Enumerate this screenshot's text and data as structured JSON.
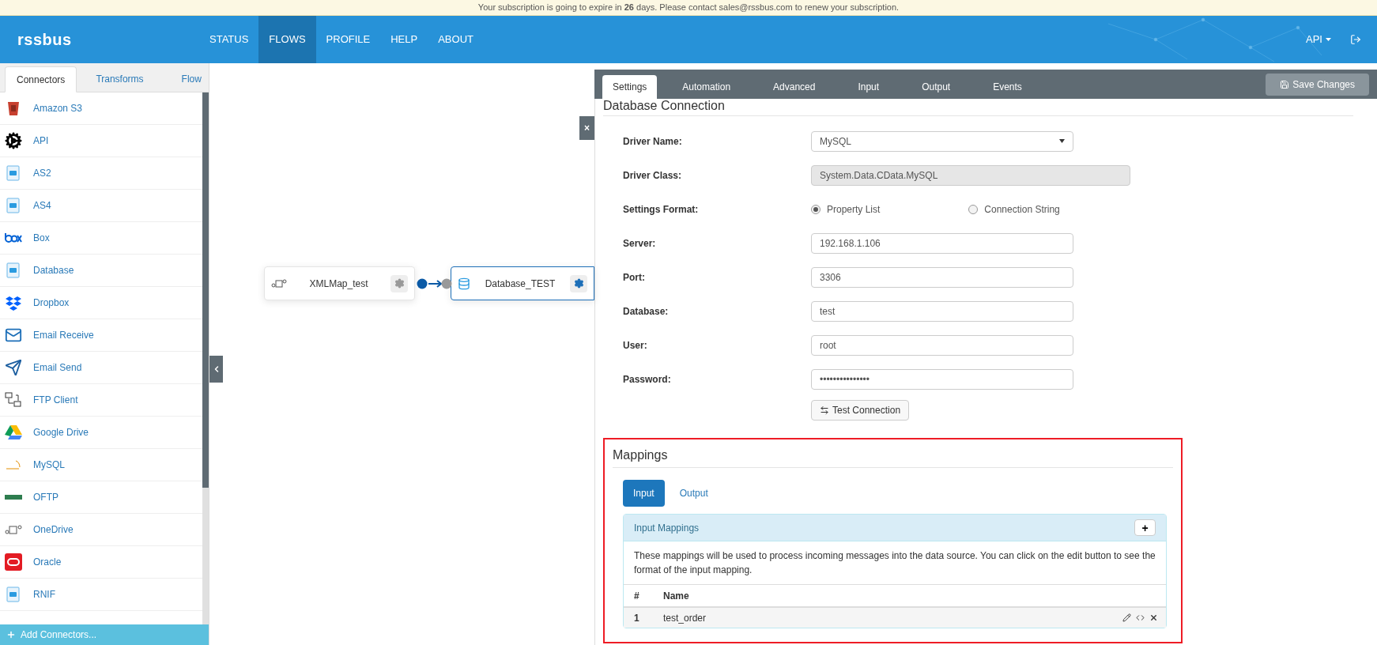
{
  "banner": {
    "text": "Your subscription is going to expire in **26** days. Please contact sales@rssbus.com to renew your subscription."
  },
  "header": {
    "logo": "rssbus",
    "nav": [
      {
        "label": "STATUS",
        "selected": false
      },
      {
        "label": "FLOWS",
        "selected": true
      },
      {
        "label": "PROFILE",
        "selected": false
      },
      {
        "label": "HELP",
        "selected": false
      },
      {
        "label": "ABOUT",
        "selected": false
      }
    ],
    "user_menu": "API"
  },
  "sidebar": {
    "tabs": [
      {
        "label": "Connectors",
        "selected": true
      },
      {
        "label": "Transforms",
        "selected": false
      },
      {
        "label": "Flow",
        "selected": false
      }
    ],
    "items": [
      {
        "label": "Amazon S3"
      },
      {
        "label": "API"
      },
      {
        "label": "AS2"
      },
      {
        "label": "AS4"
      },
      {
        "label": "Box"
      },
      {
        "label": "Database"
      },
      {
        "label": "Dropbox"
      },
      {
        "label": "Email Receive"
      },
      {
        "label": "Email Send"
      },
      {
        "label": "FTP Client"
      },
      {
        "label": "Google Drive"
      },
      {
        "label": "MySQL"
      },
      {
        "label": "OFTP"
      },
      {
        "label": "OneDrive"
      },
      {
        "label": "Oracle"
      },
      {
        "label": "RNIF"
      }
    ],
    "add_button": "Add Connectors..."
  },
  "canvas": {
    "nodes": [
      {
        "label": "XMLMap_test",
        "selected": false
      },
      {
        "label": "Database_TEST",
        "selected": true
      }
    ],
    "close_button": "×"
  },
  "panel": {
    "tabs": [
      {
        "label": "Settings",
        "selected": true
      },
      {
        "label": "Automation",
        "selected": false
      },
      {
        "label": "Advanced",
        "selected": false
      },
      {
        "label": "Input",
        "selected": false
      },
      {
        "label": "Output",
        "selected": false
      },
      {
        "label": "Events",
        "selected": false
      }
    ],
    "save_button": "Save Changes",
    "section_title": "Database Connection",
    "fields": [
      {
        "kind": "select",
        "label": "Driver Name:",
        "value": "MySQL"
      },
      {
        "kind": "readonly",
        "label": "Driver Class:",
        "value": "System.Data.CData.MySQL"
      },
      {
        "kind": "radio",
        "label": "Settings Format:",
        "options": [
          {
            "label": "Property List",
            "selected": true
          },
          {
            "label": "Connection String",
            "selected": false
          }
        ]
      },
      {
        "kind": "text",
        "label": "Server:",
        "value": "192.168.1.106"
      },
      {
        "kind": "text",
        "label": "Port:",
        "value": "3306"
      },
      {
        "kind": "text",
        "label": "Database:",
        "value": "test"
      },
      {
        "kind": "text",
        "label": "User:",
        "value": "root"
      },
      {
        "kind": "password",
        "label": "Password:",
        "value": "•••••••••••••••"
      }
    ],
    "test_button": "Test Connection",
    "mappings": {
      "title": "Mappings",
      "tabs": [
        {
          "label": "Input",
          "selected": true
        },
        {
          "label": "Output",
          "selected": false
        }
      ],
      "panel_title": "Input Mappings",
      "add_button": "+",
      "description": "These mappings will be used to process incoming messages into the data source. You can click on the edit button to see the format of the input mapping.",
      "columns": [
        "#",
        "Name"
      ],
      "rows": [
        {
          "index": "1",
          "name": "test_order"
        }
      ]
    }
  }
}
